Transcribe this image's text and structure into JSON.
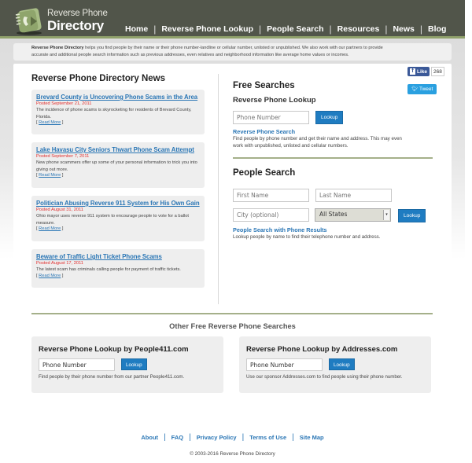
{
  "header": {
    "logo_top": "Reverse Phone",
    "logo_bottom": "Directory",
    "nav": [
      "Home",
      "Reverse Phone Lookup",
      "People Search",
      "Resources",
      "News",
      "Blog"
    ]
  },
  "intro": {
    "brand": "Reverse Phone Directory",
    "text_line1": " helps you find people by their name or their phone number-landline or cellular number, unlisted or unpublished. We also work with our partners to provide",
    "text_line2": "accurate and additional people search information such as previous addresses, even relatives and neighborhood information like average home values or incomes."
  },
  "news": {
    "title": "Reverse Phone Directory News",
    "read_more": "Read More",
    "items": [
      {
        "title": "Brevard County is Uncovering Phone Scams in the Area",
        "date": "Posted September 21, 2011",
        "summary": "The incidence of phone scams is skyrocketing for residents of Brevard County, Florida."
      },
      {
        "title": "Lake Havasu City Seniors Thwart Phone Scam Attempt",
        "date": "Posted September 7, 2011",
        "summary": "New phone scammers offer up some of your personal information to trick you into giving out more."
      },
      {
        "title": "Politician Abusing Reverse 911 System for His Own Gain",
        "date": "Posted August 31, 2011",
        "summary": "Ohio mayor uses reverse 911 system to encourage people to vote for a ballot measure."
      },
      {
        "title": "Beware of Traffic Light Ticket Phone Scams",
        "date": "Posted August 17, 2011",
        "summary": "The latest scam has criminals calling people for payment of traffic tickets."
      }
    ]
  },
  "social": {
    "like_label": "Like",
    "like_count": "268",
    "tweet_label": "Tweet"
  },
  "free_searches": {
    "title": "Free Searches",
    "reverse": {
      "heading": "Reverse Phone Lookup",
      "phone_placeholder": "Phone Number",
      "button": "Lookup",
      "link": "Reverse Phone Search",
      "desc_line1": "Find people by phone number and get their name and address. This may even",
      "desc_line2": "work with unpublished, unlisted and cellular numbers."
    },
    "people": {
      "heading": "People Search",
      "first_placeholder": "First Name",
      "last_placeholder": "Last Name",
      "city_placeholder": "City (optional)",
      "state_selected": "All States",
      "button": "Lookup",
      "link": "People Search with Phone Results",
      "desc": "Lookup people by name to find their telephone number and address."
    }
  },
  "other": {
    "title": "Other Free Reverse Phone Searches",
    "cards": [
      {
        "heading": "Reverse Phone Lookup by People411.com",
        "input_value": "Phone Number",
        "button": "Lookup",
        "desc": "Find people by their phone number from our partner People411.com."
      },
      {
        "heading": "Reverse Phone Lookup by Addresses.com",
        "input_value": "Phone Number",
        "button": "Lookup",
        "desc": "Use our sponsor Addresses.com to find people using their phone number."
      }
    ]
  },
  "footer": {
    "links": [
      "About",
      "FAQ",
      "Privacy Policy",
      "Terms of Use",
      "Site Map"
    ],
    "copyright": "© 2003-2016 Reverse Phone Directory"
  }
}
